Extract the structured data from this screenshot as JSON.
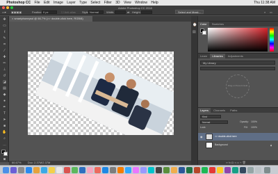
{
  "menubar": {
    "app_name": "Photoshop CC",
    "items": [
      "File",
      "Edit",
      "Image",
      "Layer",
      "Type",
      "Select",
      "Filter",
      "3D",
      "View",
      "Window",
      "Help"
    ],
    "clock": "Thu 11:38 AM"
  },
  "options_bar": {
    "window_title": "Adobe Photoshop CC 2018",
    "feather_label": "Feather:",
    "feather_value": "0 px",
    "style_label": "Style:",
    "style_value": "Normal",
    "width_label": "Width:",
    "height_label": "Height:",
    "select_mask_button": "Select and Mask..."
  },
  "document": {
    "tab_title": "smartphonepsd @ 66.7% (>> double-click here, RGB/8)",
    "zoom": "66.67%",
    "doc_info": "Doc: 2.37M/2.37M"
  },
  "color_panel": {
    "tabs": [
      "Color",
      "Swatches"
    ],
    "accent": "#d8232a"
  },
  "libraries_panel": {
    "tabs": [
      "Learn",
      "Libraries",
      "Adjustments"
    ],
    "library_name": "My Library",
    "drop_hint": "Drag or Press & Hold"
  },
  "layers_panel": {
    "tabs": [
      "Layers",
      "Channels",
      "Paths"
    ],
    "filter_label": "Kind",
    "blend_mode": "Normal",
    "opacity_label": "Opacity:",
    "opacity_value": "100%",
    "lock_label": "Lock:",
    "fill_label": "Fill:",
    "fill_value": "100%",
    "layers": [
      {
        "name": ">> double-click here",
        "selected": true
      },
      {
        "name": "Background",
        "selected": false
      }
    ]
  },
  "tools": [
    "move-tool",
    "marquee-tool",
    "lasso-tool",
    "quick-select-tool",
    "crop-tool",
    "eyedropper-tool",
    "healing-tool",
    "brush-tool",
    "clone-tool",
    "history-brush-tool",
    "eraser-tool",
    "gradient-tool",
    "blur-tool",
    "dodge-tool",
    "pen-tool",
    "type-tool",
    "path-select-tool",
    "shape-tool",
    "hand-tool",
    "zoom-tool"
  ]
}
